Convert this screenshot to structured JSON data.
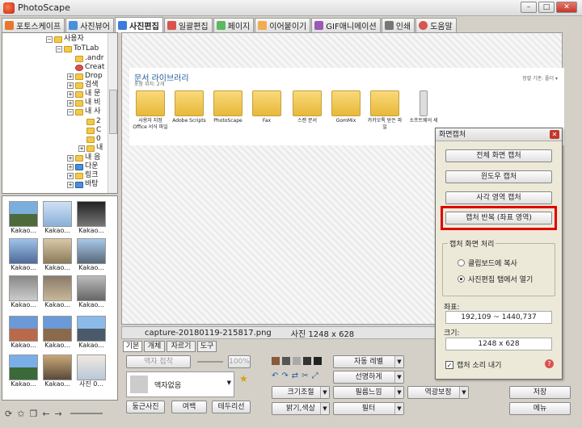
{
  "app": {
    "title": "PhotoScape"
  },
  "tabs": [
    {
      "label": "포토스케이프",
      "color": "#e8772a"
    },
    {
      "label": "사진뷰어",
      "color": "#4a90d9"
    },
    {
      "label": "사진편집",
      "color": "#3b7dd8"
    },
    {
      "label": "일괄편집",
      "color": "#d9534f"
    },
    {
      "label": "페이지",
      "color": "#5cb85c"
    },
    {
      "label": "이어붙이기",
      "color": "#f0ad4e"
    },
    {
      "label": "GIF애니메이션",
      "color": "#9b59b6"
    },
    {
      "label": "인쇄",
      "color": "#777777"
    },
    {
      "label": "도움말",
      "color": "#d9534f"
    }
  ],
  "tree": [
    "사용자",
    "ToTLab",
    ".andr",
    "Creat",
    "Drop",
    "검색",
    "내 문",
    "내 비",
    "내 사",
    "2",
    "C",
    "0",
    "내",
    "내 음",
    "다운",
    "링크",
    "바탕"
  ],
  "thumbs": [
    "Kakao...",
    "Kakao...",
    "Kakao...",
    "Kakao...",
    "Kakao...",
    "Kakao...",
    "Kakao...",
    "Kakao...",
    "Kakao...",
    "Kakao...",
    "Kakao...",
    "Kakao...",
    "Kakao...",
    "Kakao...",
    "사진 0..."
  ],
  "library": {
    "title": "문서 라이브러리",
    "subtitle": "포함 위치: 2개",
    "sort": "정렬 기준: 폴더 ▾",
    "folders": [
      "사용자 지정 Office 서식 파일",
      "Adobe Scripts",
      "PhotoScape",
      "Fax",
      "스캔 문서",
      "GomMix",
      "카카오톡 받은 파일",
      "소프트웨어 세"
    ]
  },
  "filebar": {
    "filename": "capture-20180119-215817.png",
    "size": "사진 1248 x 628"
  },
  "bottom": {
    "tabs": [
      "기본",
      "개체",
      "자르기",
      "도구"
    ],
    "frame_btn": "액자 접착",
    "percent": "100%",
    "frame_select": "액자없음",
    "round_btn": "둥근사진",
    "margin_btn": "여백",
    "border_btn": "테두리선",
    "auto_level": "자동 레벨",
    "sharpen": "선명하게",
    "resize": "크기조절",
    "film": "필름느낌",
    "bright": "밝기,색상",
    "filter": "필터",
    "backlight": "역광보정",
    "save": "저장",
    "menu": "메뉴"
  },
  "dialog": {
    "title": "화면캡처",
    "full": "전체 화면 캡처",
    "window": "윈도우 캡처",
    "region": "사각 영역 캡처",
    "repeat": "캡처 반복 (좌표 영역)",
    "process_label": "캡처 화면 처리",
    "opt_clipboard": "클립보드에 복사",
    "opt_open": "사진편집 탭에서 열기",
    "coord_label": "좌표:",
    "coord": "192,109 ~ 1440,737",
    "size_label": "크기:",
    "size": "1248 x 628",
    "sound": "캡처 소리 내기"
  }
}
